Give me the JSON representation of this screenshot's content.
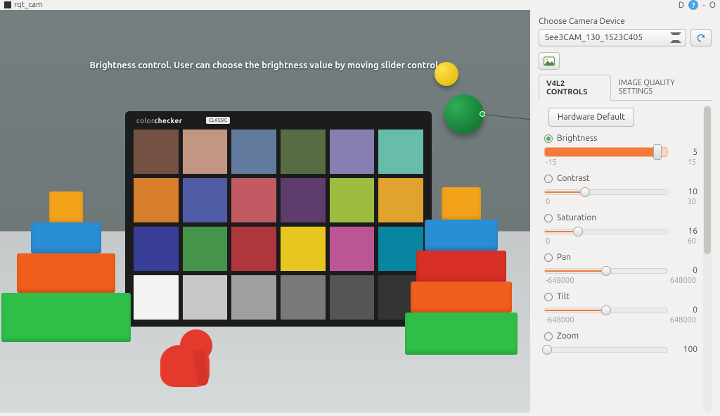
{
  "title": "rqt_cam",
  "titlebar_right": {
    "d": "D",
    "dash": "-",
    "o": "O"
  },
  "hint": "Brightness control. User can choose the brightness value by moving slider control.",
  "colorchecker": {
    "brand_pre": "color",
    "brand_bold": "checker",
    "tag": "CLASSIC",
    "colors": [
      "#735244",
      "#c29682",
      "#627a9d",
      "#576c43",
      "#8580b1",
      "#67bdaa",
      "#d67e2c",
      "#505ba6",
      "#c15a63",
      "#5e3c6c",
      "#9dbc40",
      "#e0a32e",
      "#383d96",
      "#469449",
      "#af363c",
      "#e7c71f",
      "#bb5695",
      "#0885a1",
      "#f3f3f2",
      "#c8c8c8",
      "#a0a0a0",
      "#7a7a7a",
      "#555555",
      "#343434"
    ]
  },
  "panel": {
    "choose_label": "Choose Camera Device",
    "device": "See3CAM_130_1523C405",
    "tabs": {
      "v4l2": "V4L2 CONTROLS",
      "iq": "IMAGE QUALITY SETTINGS"
    },
    "default_btn": "Hardware Default"
  },
  "controls": [
    {
      "key": "brightness",
      "label": "Brightness",
      "value": 5,
      "min": -15,
      "max": 15,
      "percent": 92,
      "active": true
    },
    {
      "key": "contrast",
      "label": "Contrast",
      "value": 10,
      "min": 0,
      "max": 30,
      "percent": 33
    },
    {
      "key": "saturation",
      "label": "Saturation",
      "value": 16,
      "min": 0,
      "max": 60,
      "percent": 27
    },
    {
      "key": "pan",
      "label": "Pan",
      "value": 0,
      "min": -648000,
      "max": 648000,
      "percent": 50
    },
    {
      "key": "tilt",
      "label": "Tilt",
      "value": 0,
      "min": -648000,
      "max": 648000,
      "percent": 50
    },
    {
      "key": "zoom",
      "label": "Zoom",
      "value": 100,
      "min": 0,
      "max": 0,
      "percent": 2
    }
  ]
}
